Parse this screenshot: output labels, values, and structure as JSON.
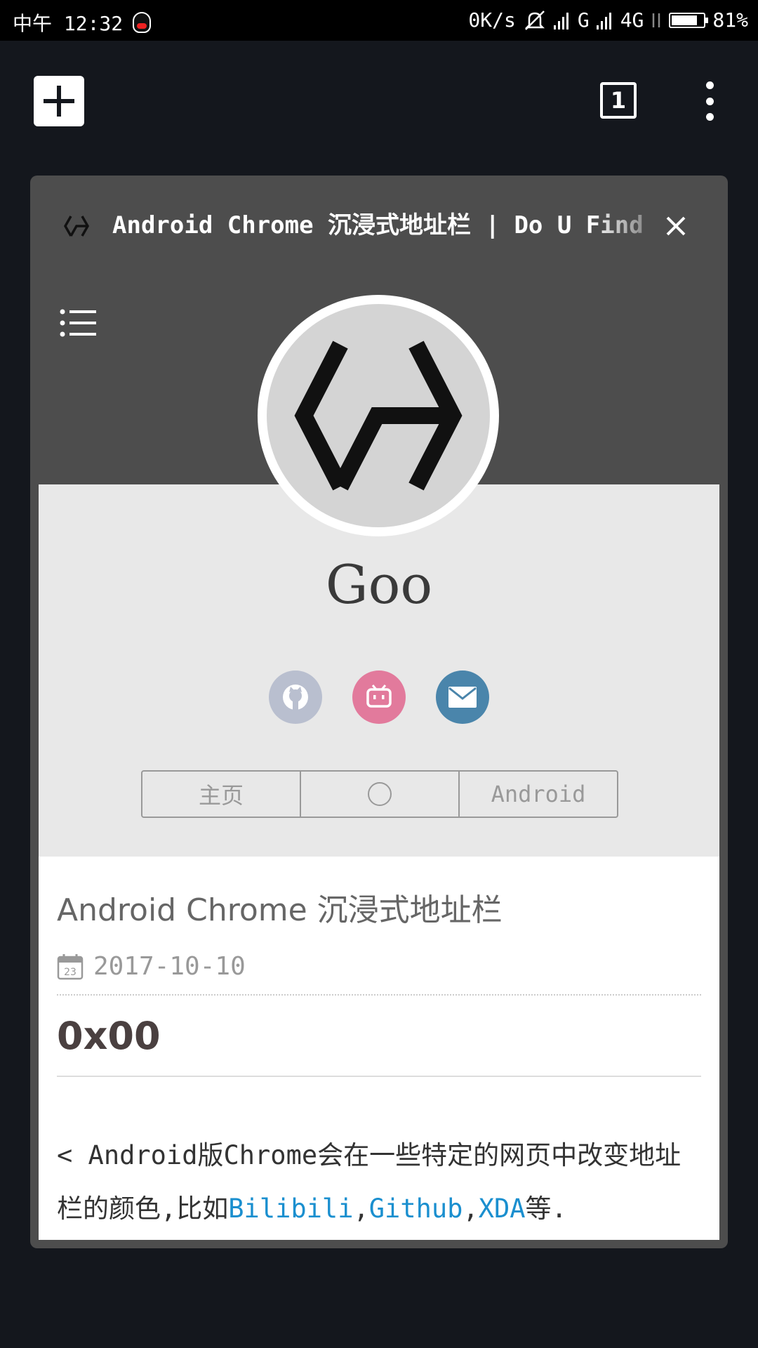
{
  "status_bar": {
    "time": "中午 12:32",
    "net_speed": "0K/s",
    "signal_1": "G",
    "signal_2": "4G",
    "battery_percent": "81%",
    "battery_level": 0.81
  },
  "toolbar": {
    "new_tab_icon": "plus-icon",
    "tab_count": "1",
    "menu_icon": "more-vert-icon"
  },
  "tab_card": {
    "title": "Android Chrome 沉浸式地址栏 | Do U Find",
    "favicon": "site-logo-icon",
    "close_icon": "close-icon"
  },
  "page": {
    "menu_icon": "list-menu-icon",
    "site_name": "Goo",
    "social": [
      {
        "name": "github-icon",
        "color": "#b9bfcf"
      },
      {
        "name": "bilibili-icon",
        "color": "#e27a9c"
      },
      {
        "name": "mail-icon",
        "color": "#4a85ab"
      }
    ],
    "nav": {
      "home": "主页",
      "android": "Android"
    },
    "article": {
      "title": "Android Chrome 沉浸式地址栏",
      "date": "2017-10-10",
      "heading": "0x00",
      "para_part1": "< Android版Chrome会在一些特定的网页中改变地址栏的颜色,比如",
      "link1": "Bilibili",
      "sep1": ",",
      "link2": "Github",
      "sep2": ",",
      "link3": "XDA",
      "para_end": "等."
    },
    "link_color": "#1a8fcf"
  }
}
